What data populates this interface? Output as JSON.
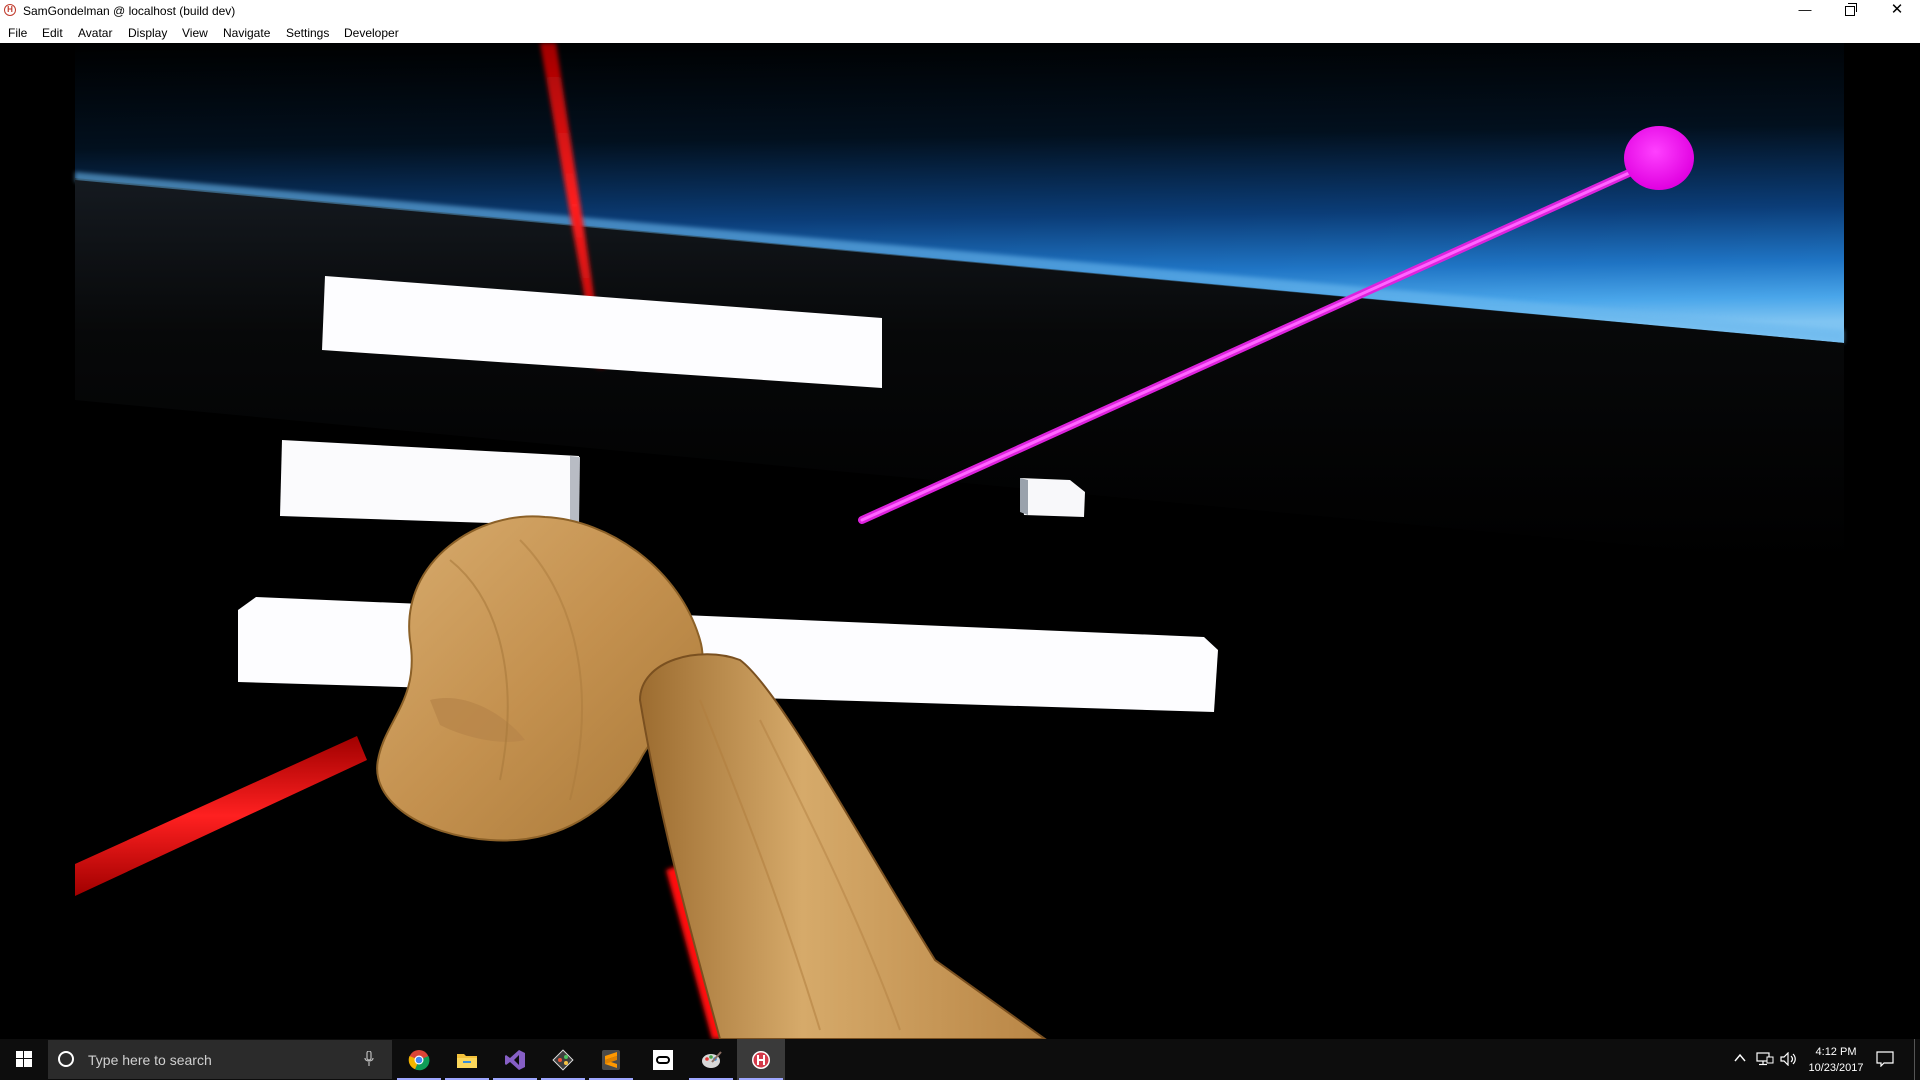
{
  "window": {
    "title": "SamGondelman @ localhost (build dev)",
    "app_icon_glyph": "H",
    "minimize_glyph": "—",
    "close_glyph": "✕"
  },
  "menu": {
    "items": [
      "File",
      "Edit",
      "Avatar",
      "Display",
      "View",
      "Navigate",
      "Settings",
      "Developer"
    ]
  },
  "scene": {
    "colors": {
      "sky_top": "#000000",
      "sky_horizon": "#2a8ad8",
      "laser_red": "#ff1a1a",
      "laser_magenta": "#e020e0",
      "target_sphere": "#ff00ff",
      "panel_white": "#fdfdff",
      "hand_wood": "#c89a5c"
    }
  },
  "taskbar": {
    "search_placeholder": "Type here to search",
    "apps": [
      {
        "name": "chrome-icon",
        "active": false
      },
      {
        "name": "file-explorer-icon",
        "active": false
      },
      {
        "name": "visual-studio-icon",
        "active": false
      },
      {
        "name": "git-icon",
        "active": false
      },
      {
        "name": "sublime-text-icon",
        "active": false
      },
      {
        "name": "oculus-icon",
        "active": false
      },
      {
        "name": "paint-icon",
        "active": false
      },
      {
        "name": "high-fidelity-icon",
        "active": true
      }
    ],
    "clock": {
      "time": "4:12 PM",
      "date": "10/23/2017"
    }
  }
}
